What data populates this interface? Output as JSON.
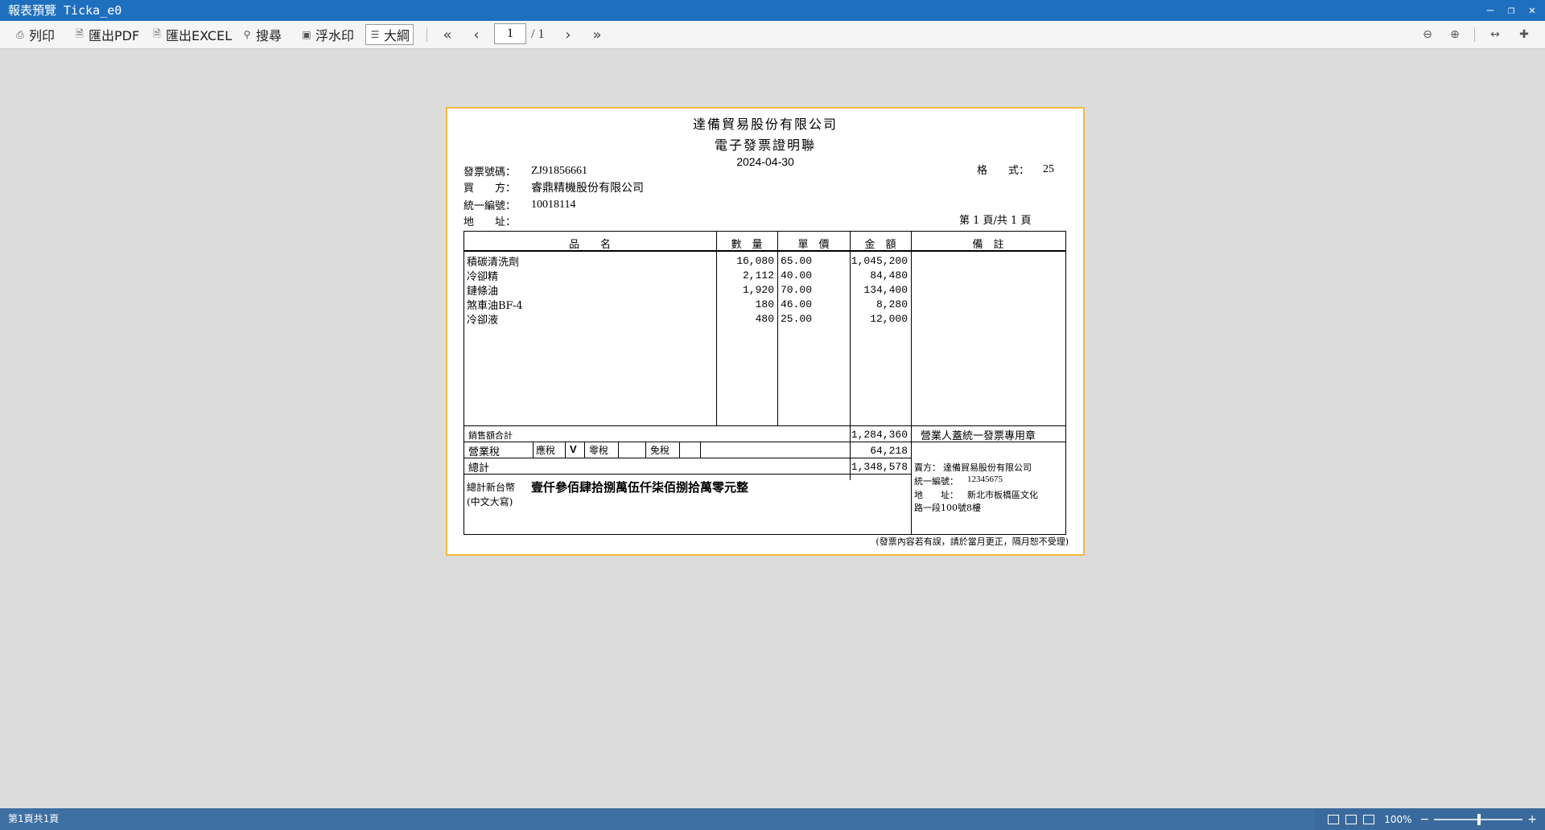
{
  "window": {
    "title": "報表預覽 Ticka_e0"
  },
  "toolbar": {
    "print": "列印",
    "export_pdf": "匯出PDF",
    "export_excel": "匯出EXCEL",
    "search": "搜尋",
    "watermark": "浮水印",
    "outline": "大綱",
    "page_current": "1",
    "page_total": "/ 1"
  },
  "invoice": {
    "company": "達備貿易股份有限公司",
    "doc_title": "電子發票證明聯",
    "date": "2024-04-30",
    "invoice_no_label": "發票號碼：",
    "invoice_no": "ZJ91856661",
    "buyer_label": "買　　方：",
    "buyer": "睿鼎精機股份有限公司",
    "tax_id_label": "統一編號：",
    "tax_id": "10018114",
    "address_label": "地　　址：",
    "format_label": "格　　式：",
    "format_value": "25",
    "page_info": "第 1 頁/共 1 頁",
    "headers": {
      "item": "品　　名",
      "qty": "數　量",
      "price": "單　價",
      "amount": "金　額",
      "note": "備　註"
    },
    "rows": [
      {
        "item": "積碳清洗劑",
        "qty": "16,080",
        "price": "65.00",
        "amount": "1,045,200"
      },
      {
        "item": "冷卻精",
        "qty": "2,112",
        "price": "40.00",
        "amount": "84,480"
      },
      {
        "item": "鏈條油",
        "qty": "1,920",
        "price": "70.00",
        "amount": "134,400"
      },
      {
        "item": "煞車油BF-4",
        "qty": "180",
        "price": "46.00",
        "amount": "8,280"
      },
      {
        "item": "冷卻液",
        "qty": "480",
        "price": "25.00",
        "amount": "12,000"
      }
    ],
    "sales_total_label": "銷售額合計",
    "sales_total": "1,284,360",
    "tax_label": "營業稅",
    "taxable_label": "應稅",
    "taxable_mark": "V",
    "zero_rate_label": "零稅",
    "exempt_label": "免稅",
    "tax_amount": "64,218",
    "grand_total_label": "總計",
    "grand_total": "1,348,578",
    "chinese_total_label": "總計新台幣",
    "chinese_total_sub": "(中文大寫)",
    "chinese_total": "壹仟參佰肆拾捌萬伍仟柒佰捌拾萬零元整",
    "stamp_title": "營業人蓋統一發票專用章",
    "seller_label": "賣方：",
    "seller": "達備貿易股份有限公司",
    "seller_tax_id_label": "統一編號：",
    "seller_tax_id": "12345675",
    "seller_addr_label": "地　　址：",
    "seller_addr_1": "新北市板橋區文化",
    "seller_addr_2": "路一段100號8樓",
    "footer_note": "(發票內容若有誤，請於當月更正，隔月恕不受理)"
  },
  "status": {
    "left": "第1頁共1頁",
    "zoom": "100%"
  }
}
